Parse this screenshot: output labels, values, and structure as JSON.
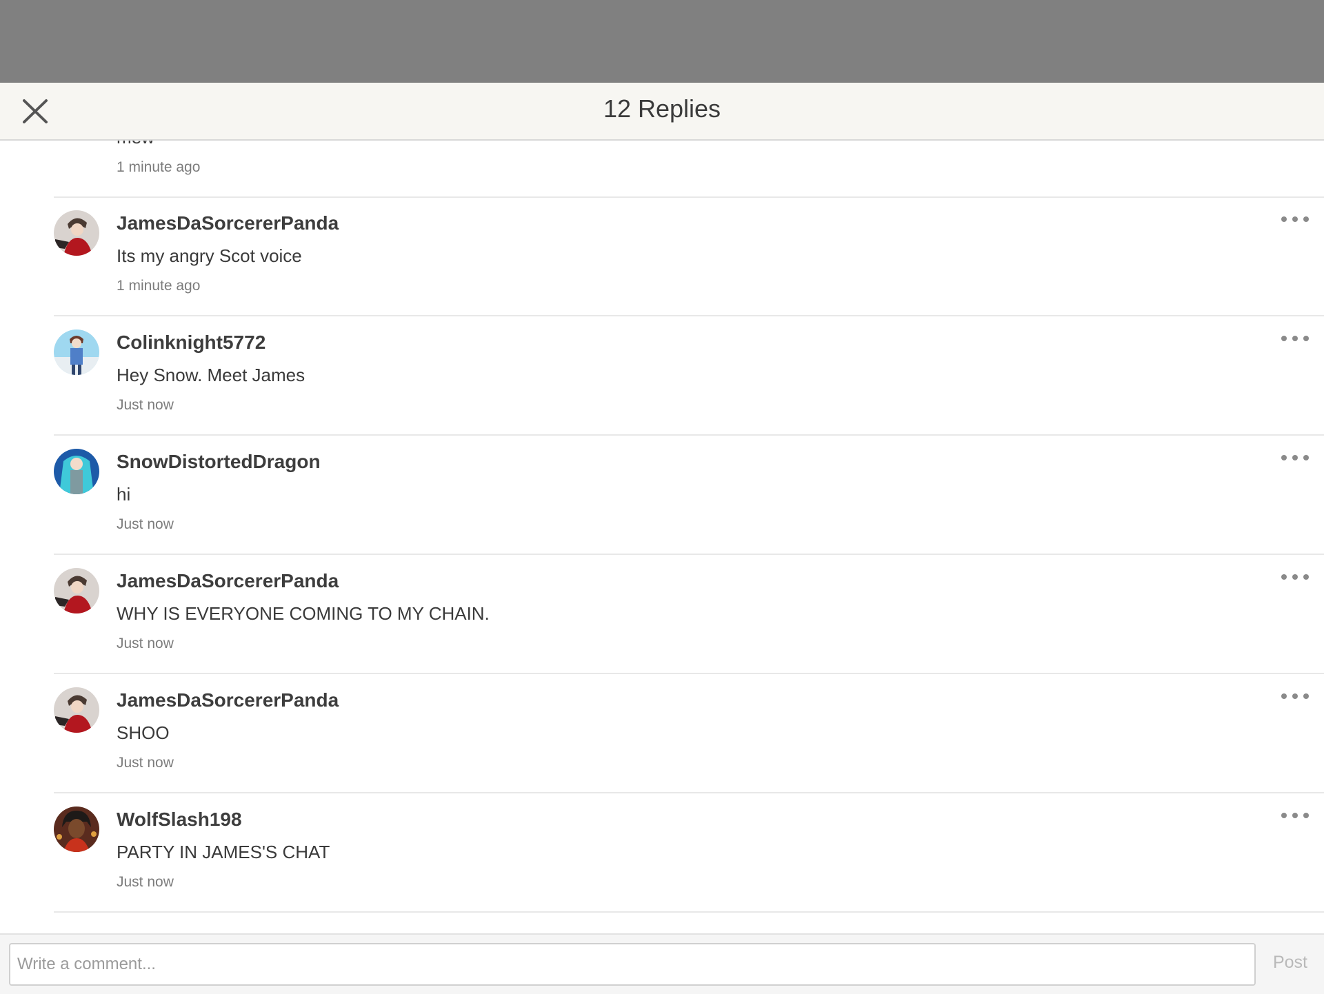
{
  "header": {
    "title": "12 Replies",
    "close_icon": "close-icon"
  },
  "replies": [
    {
      "username": "",
      "message": "mew",
      "time": "1 minute ago",
      "avatar": "teal-hair-avatar"
    },
    {
      "username": "JamesDaSorcererPanda",
      "message": "Its my angry Scot voice",
      "time": "1 minute ago",
      "avatar": "red-jacket-avatar"
    },
    {
      "username": "Colinknight5772",
      "message": "Hey Snow. Meet James",
      "time": "Just now",
      "avatar": "blue-suit-avatar"
    },
    {
      "username": "SnowDistortedDragon",
      "message": "hi",
      "time": "Just now",
      "avatar": "teal-hair-avatar"
    },
    {
      "username": "JamesDaSorcererPanda",
      "message": "WHY IS EVERYONE COMING TO MY CHAIN.",
      "time": "Just now",
      "avatar": "red-jacket-avatar"
    },
    {
      "username": "JamesDaSorcererPanda",
      "message": "SHOO",
      "time": "Just now",
      "avatar": "red-jacket-avatar"
    },
    {
      "username": "WolfSlash198",
      "message": "PARTY IN JAMES'S CHAT",
      "time": "Just now",
      "avatar": "dark-hair-avatar"
    }
  ],
  "composer": {
    "placeholder": "Write a comment...",
    "post_label": "Post"
  },
  "colors": {
    "topbar": "#808080",
    "header_bg": "#f7f6f2",
    "divider": "#e8e8e8",
    "timestamp": "#7c7c7c"
  }
}
